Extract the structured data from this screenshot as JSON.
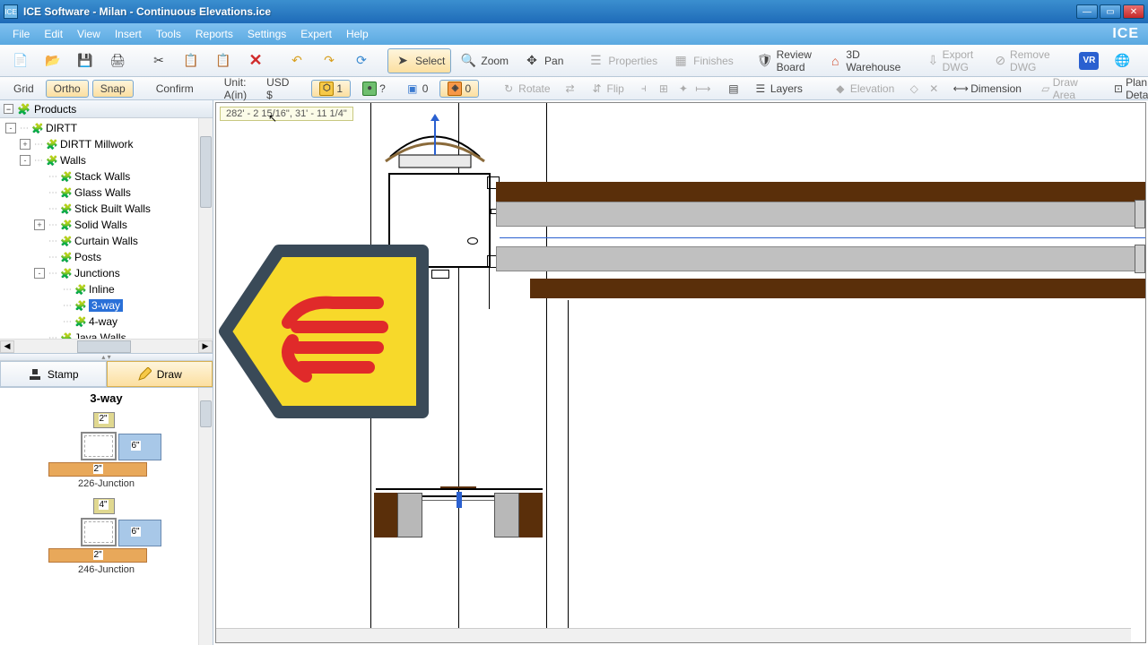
{
  "window": {
    "title": "ICE Software - Milan - Continuous Elevations.ice",
    "app_abbrev": "ICE",
    "brand": "ICE"
  },
  "menu": {
    "items": [
      "File",
      "Edit",
      "View",
      "Insert",
      "Tools",
      "Reports",
      "Settings",
      "Expert",
      "Help"
    ]
  },
  "toolbar_main": {
    "select": "Select",
    "zoom": "Zoom",
    "pan": "Pan",
    "properties": "Properties",
    "finishes": "Finishes",
    "review_board": "Review Board",
    "warehouse": "3D Warehouse",
    "export_dwg": "Export DWG",
    "remove_dwg": "Remove DWG"
  },
  "toolbar2": {
    "grid": "Grid",
    "ortho": "Ortho",
    "snap": "Snap",
    "confirm": "Confirm",
    "unit": "Unit: A(in)",
    "currency": "USD $",
    "badge1": "1",
    "badge_q": "?",
    "badge0": "0",
    "badge0b": "0",
    "rotate": "Rotate",
    "flip": "Flip",
    "layers": "Layers",
    "elevation": "Elevation",
    "dimension": "Dimension",
    "draw_area": "Draw Area",
    "plan_detail": "Plan Detail"
  },
  "tree": {
    "header": "Products",
    "items": [
      {
        "depth": 0,
        "exp": "-",
        "label": "DIRTT"
      },
      {
        "depth": 1,
        "exp": "+",
        "label": "DIRTT Millwork"
      },
      {
        "depth": 1,
        "exp": "-",
        "label": "Walls"
      },
      {
        "depth": 2,
        "exp": "",
        "label": "Stack Walls"
      },
      {
        "depth": 2,
        "exp": "",
        "label": "Glass Walls"
      },
      {
        "depth": 2,
        "exp": "",
        "label": "Stick Built Walls"
      },
      {
        "depth": 2,
        "exp": "+",
        "label": "Solid Walls"
      },
      {
        "depth": 2,
        "exp": "",
        "label": "Curtain Walls"
      },
      {
        "depth": 2,
        "exp": "",
        "label": "Posts"
      },
      {
        "depth": 2,
        "exp": "-",
        "label": "Junctions"
      },
      {
        "depth": 3,
        "exp": "",
        "label": "Inline"
      },
      {
        "depth": 3,
        "exp": "",
        "label": "3-way",
        "selected": true
      },
      {
        "depth": 3,
        "exp": "",
        "label": "4-way"
      },
      {
        "depth": 2,
        "exp": "",
        "label": "Java Walls"
      }
    ]
  },
  "tabs": {
    "stamp": "Stamp",
    "draw": "Draw"
  },
  "preview": {
    "title": "3-way",
    "items": [
      {
        "caption": "226-Junction",
        "top_dim": "2\"",
        "side_dim": "6\"",
        "bot_dim": "2\""
      },
      {
        "caption": "246-Junction",
        "top_dim": "4\"",
        "side_dim": "6\"",
        "bot_dim": "2\""
      }
    ]
  },
  "canvas": {
    "coords": "282' - 2 15/16\", 31' - 11 1/4\""
  }
}
